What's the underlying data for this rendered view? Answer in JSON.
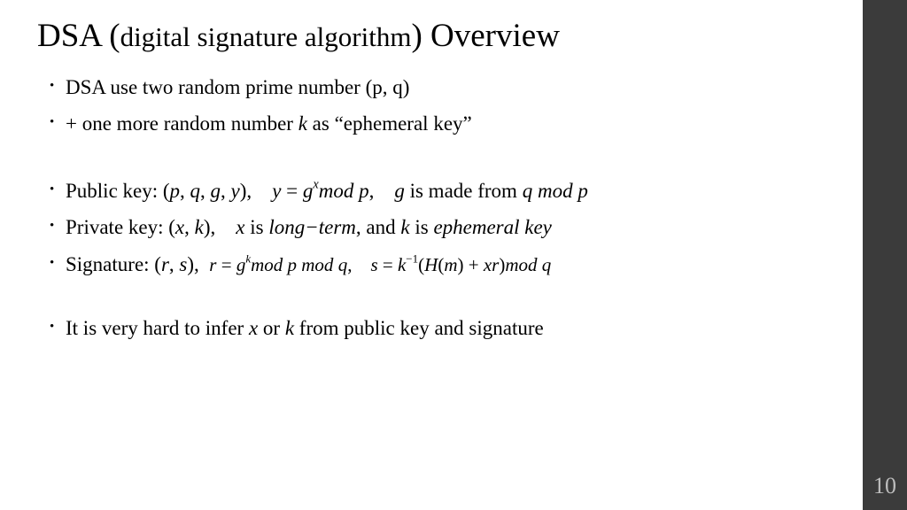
{
  "pageNumber": "10",
  "title": {
    "prefix": "DSA (",
    "mid": "digital signature algorithm",
    "suffix": ") Overview"
  },
  "bullets": {
    "b1": "DSA use two random prime number (p, q)",
    "b2_a": "+ one more random number ",
    "b2_k": "k",
    "b2_b": " as “ephemeral key”",
    "b3_a": "Public key: (",
    "b3_p": "p",
    "b3_c1": ", ",
    "b3_q": "q",
    "b3_c2": ", ",
    "b3_g1": "g",
    "b3_c3": ", ",
    "b3_y1": "y",
    "b3_b": "), ",
    "b3_y2": "y",
    "b3_eq": " = ",
    "b3_g2": "g",
    "b3_x1": "x",
    "b3_mod1": "mod",
    "b3_sp1": " ",
    "b3_p2": "p",
    "b3_c": ", ",
    "b3_g3": "g",
    "b3_mid": " is made from ",
    "b3_q2": "q",
    "b3_sp2": " ",
    "b3_mod2": "mod",
    "b3_sp3": " ",
    "b3_p3": "p",
    "b4_a": "Private key: (",
    "b4_x": "x",
    "b4_c1": ", ",
    "b4_k": "k",
    "b4_b": "), ",
    "b4_x2": "x",
    "b4_is1": " is ",
    "b4_lt": "long−term",
    "b4_and": ", and ",
    "b4_k2": "k",
    "b4_is2": " is ",
    "b4_ek": "ephemeral key",
    "b5_a": "Signature: (",
    "b5_r": "r",
    "b5_c1": ", ",
    "b5_s": "s",
    "b5_b": "), ",
    "b5_r2": "r",
    "b5_eq1": " = ",
    "b5_g": "g",
    "b5_k": "k",
    "b5_mod1": "mod",
    "b5_p": "p",
    "b5_mod2": "mod",
    "b5_q": "q",
    "b5_cc": ", ",
    "b5_s2": "s",
    "b5_eq2": " = ",
    "b5_k2": "k",
    "b5_m1": "−1",
    "b5_lp": "(",
    "b5_H": "H",
    "b5_lp2": "(",
    "b5_m": "m",
    "b5_rp2": ")",
    "b5_pl": " + ",
    "b5_x": "x",
    "b5_r3": "r",
    "b5_rp": ")",
    "b5_mod3": "mod",
    "b5_q2": "q",
    "b6_a": "It is very hard to infer ",
    "b6_x": "x",
    "b6_or": " or ",
    "b6_k": "k",
    "b6_b": " from public key and signature"
  }
}
